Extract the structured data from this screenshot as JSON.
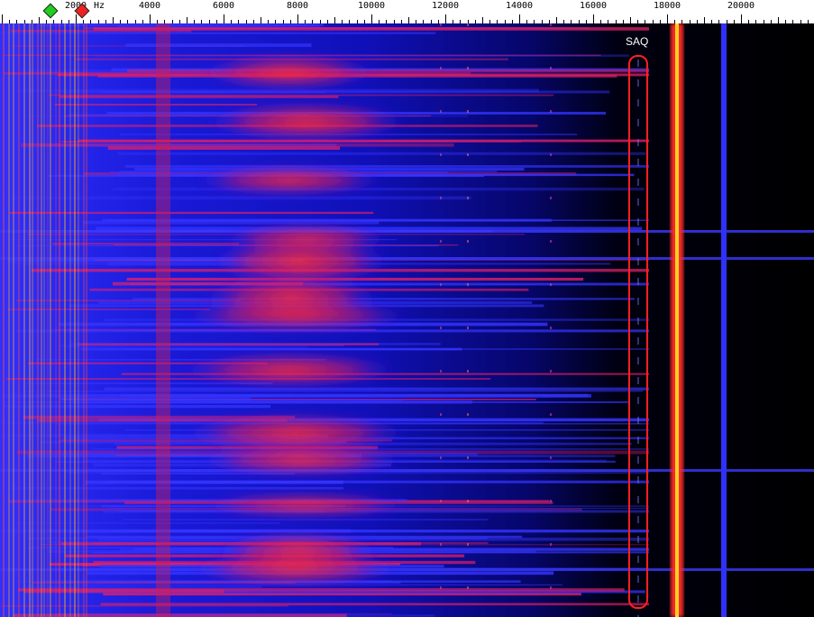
{
  "ruler": {
    "unit": "Hz",
    "tick_labels": [
      "2000",
      "4000",
      "6000",
      "8000",
      "10000",
      "12000",
      "14000",
      "16000",
      "18000",
      "20000"
    ],
    "max_hz": 22050
  },
  "markers": {
    "low_marker_color": "#22cc22",
    "high_marker_color": "#ee2222"
  },
  "annotation": {
    "label": "SAQ",
    "color": "#ff2020",
    "frequency_hz": 17200
  },
  "colors": {
    "background": "#000000",
    "noise": "#1010ff",
    "hot": "#ff2a2a",
    "peak": "#ffe000"
  }
}
